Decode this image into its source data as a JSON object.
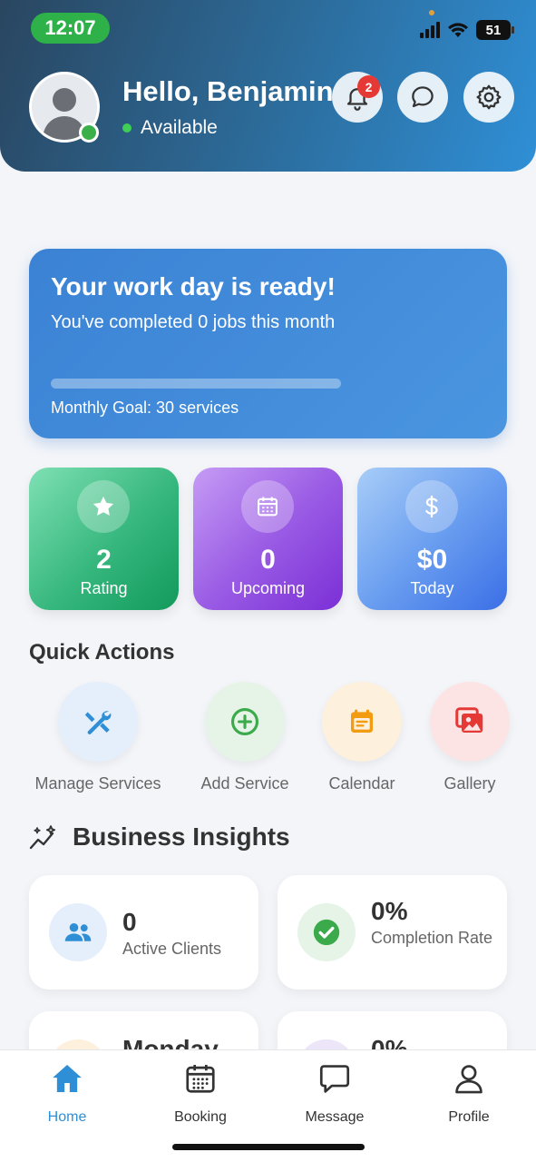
{
  "status_bar": {
    "time": "12:07",
    "battery": "51"
  },
  "header": {
    "greeting": "Hello, Benjamin",
    "availability": "Available",
    "notification_count": "2",
    "icons": [
      "bell-icon",
      "chat-icon",
      "gear-icon"
    ]
  },
  "work_card": {
    "title": "Your work day is ready!",
    "subtitle": "You've completed 0 jobs this month",
    "progress_fraction": 0,
    "goal_text": "Monthly Goal: 30 services"
  },
  "stats": [
    {
      "value": "2",
      "label": "Rating",
      "icon": "star-icon"
    },
    {
      "value": "0",
      "label": "Upcoming",
      "icon": "calendar-icon"
    },
    {
      "value": "$0",
      "label": "Today",
      "icon": "dollar-icon"
    }
  ],
  "quick_actions": {
    "title": "Quick Actions",
    "items": [
      {
        "label": "Manage Services",
        "icon": "tools-icon",
        "color": "#2f8fd6"
      },
      {
        "label": "Add Service",
        "icon": "plus-circle-icon",
        "color": "#3aaa4a"
      },
      {
        "label": "Calendar",
        "icon": "calendar-icon",
        "color": "#f39c12"
      },
      {
        "label": "Gallery",
        "icon": "gallery-icon",
        "color": "#e53935"
      }
    ]
  },
  "insights": {
    "title": "Business Insights",
    "cards": [
      {
        "value": "0",
        "label": "Active Clients",
        "icon": "people-icon"
      },
      {
        "value": "0%",
        "label": "Completion Rate",
        "icon": "check-circle-icon"
      },
      {
        "value": "Monday",
        "label": "",
        "icon": "calendar-icon"
      },
      {
        "value": "0%",
        "label": "",
        "icon": "chart-icon"
      }
    ]
  },
  "bottom_nav": {
    "items": [
      {
        "label": "Home",
        "icon": "home-icon",
        "active": true
      },
      {
        "label": "Booking",
        "icon": "calendar-grid-icon"
      },
      {
        "label": "Message",
        "icon": "message-icon"
      },
      {
        "label": "Profile",
        "icon": "person-icon"
      }
    ],
    "active_color": "#2f8fd6"
  }
}
